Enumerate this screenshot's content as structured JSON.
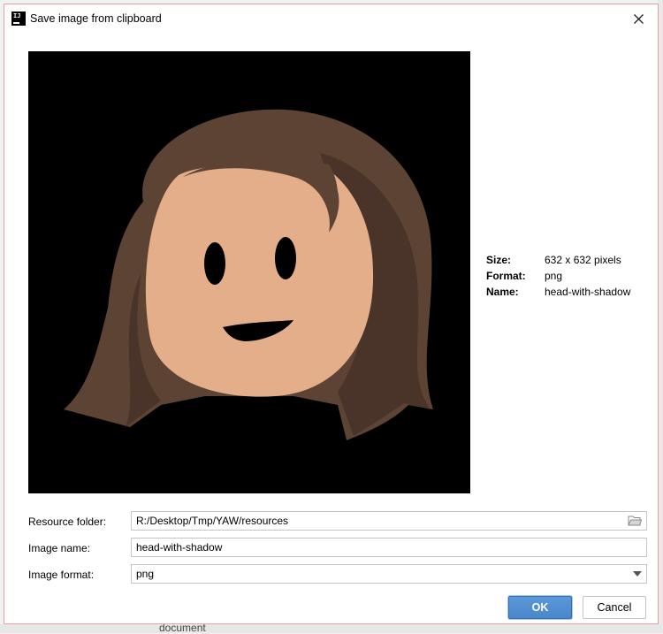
{
  "window": {
    "title": "Save image from clipboard",
    "app_icon_text": "IJ"
  },
  "background": {
    "partial_text": "document"
  },
  "image_info": {
    "size_label": "Size:",
    "size_value": "632 x 632 pixels",
    "format_label": "Format:",
    "format_value": "png",
    "name_label": "Name:",
    "name_value": "head-with-shadow"
  },
  "form": {
    "resource_folder_label": "Resource folder:",
    "resource_folder_value": "R:/Desktop/Tmp/YAW/resources",
    "image_name_label": "Image name:",
    "image_name_value": "head-with-shadow",
    "image_format_label": "Image format:",
    "image_format_value": "png"
  },
  "buttons": {
    "ok_label": "OK",
    "cancel_label": "Cancel"
  },
  "icons": {
    "close": "close-icon",
    "folder": "folder-icon",
    "dropdown": "chevron-down-icon"
  },
  "colors": {
    "preview_background": "#000000",
    "hair": "#5c4333",
    "hair_shadow": "#4a3329",
    "skin": "#e4ae8a",
    "ok_button": "#4a86cb",
    "dialog_border": "#e6a1a6"
  }
}
